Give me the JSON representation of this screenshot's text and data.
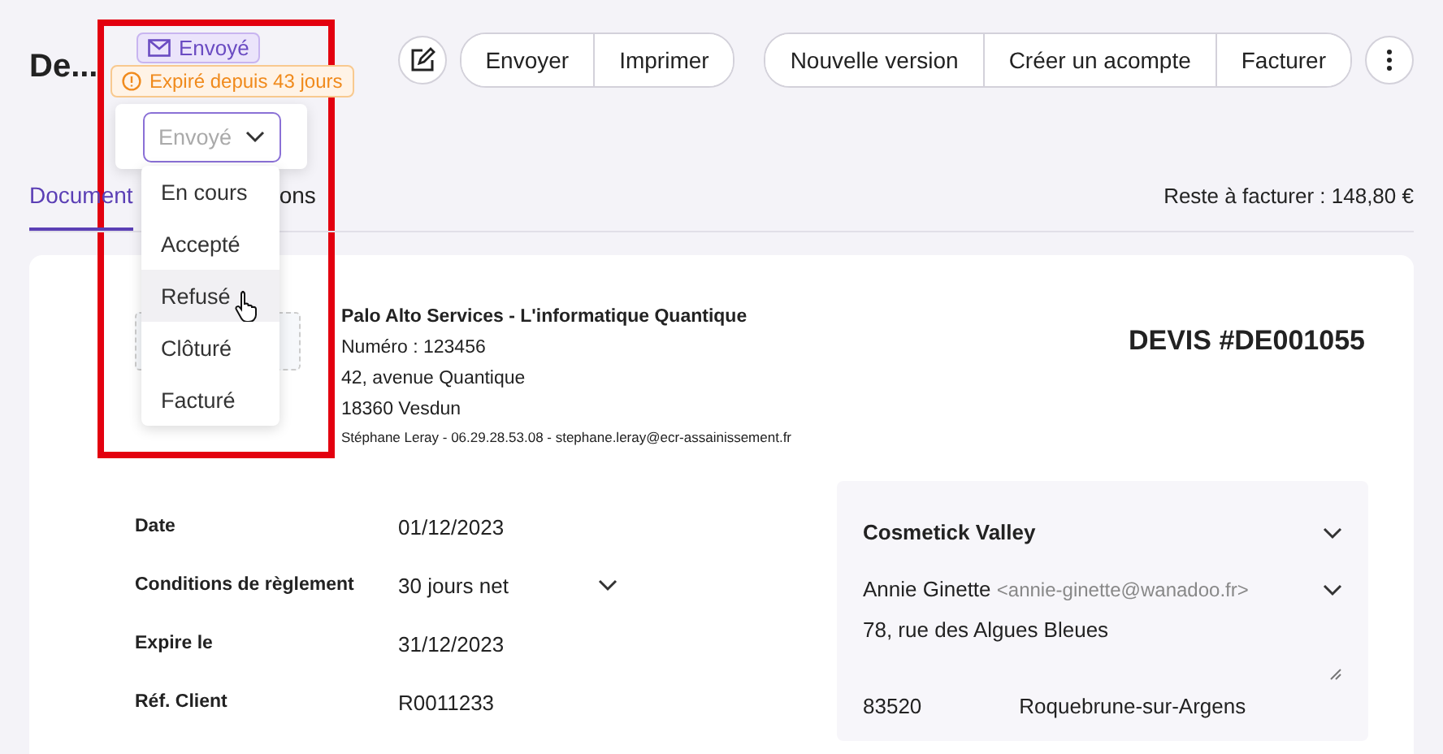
{
  "header": {
    "title": "De...",
    "status_badge": "Envoyé",
    "expiry_badge": "Expiré depuis 43 jours",
    "action_groups": [
      [
        "Envoyer",
        "Imprimer"
      ],
      [
        "Nouvelle version",
        "Créer un acompte",
        "Facturer"
      ]
    ]
  },
  "status_dropdown": {
    "placeholder": "Envoyé",
    "options": [
      {
        "label": "En cours",
        "hovered": false
      },
      {
        "label": "Accepté",
        "hovered": false
      },
      {
        "label": "Refusé",
        "hovered": true
      },
      {
        "label": "Clôturé",
        "hovered": false
      },
      {
        "label": "Facturé",
        "hovered": false
      }
    ]
  },
  "tabs": [
    {
      "label": "Document",
      "selected": true
    },
    {
      "label": "ons",
      "selected": false
    }
  ],
  "remaining": "Reste à facturer : 148,80 €",
  "company": {
    "name": "Palo Alto Services - L'informatique Quantique",
    "number": "Numéro : 123456",
    "street": "42, avenue Quantique",
    "city": "18360 Vesdun",
    "contact": "Stéphane Leray - 06.29.28.53.08 - stephane.leray@ecr-assainissement.fr"
  },
  "doc_title": "DEVIS #DE001055",
  "fields": [
    {
      "label": "Date",
      "value": "01/12/2023",
      "kind": "text"
    },
    {
      "label": "Conditions de règlement",
      "value": "30 jours net",
      "kind": "select"
    },
    {
      "label": "Expire le",
      "value": "31/12/2023",
      "kind": "text"
    },
    {
      "label": "Réf. Client",
      "value": "R0011233",
      "kind": "text"
    }
  ],
  "client": {
    "company": "Cosmetick Valley",
    "contact_name": "Annie Ginette",
    "contact_email": "<annie-ginette@wanadoo.fr>",
    "address": "78, rue des Algues Bleues",
    "postcode": "83520",
    "city": "Roquebrune-sur-Argens"
  }
}
